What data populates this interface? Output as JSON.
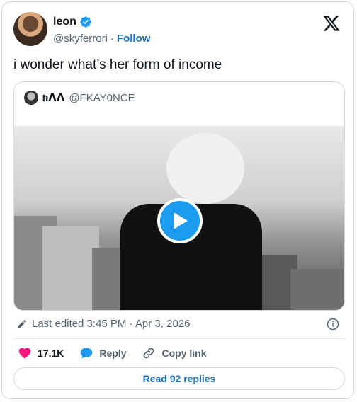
{
  "author": {
    "name": "leon",
    "handle": "@skyferrori",
    "separator": "·",
    "follow_label": "Follow"
  },
  "tweet": {
    "text": "i wonder what’s her form of income"
  },
  "quoted": {
    "name": "ክᐱᐱ",
    "handle": "@FKAY0NCE"
  },
  "meta": {
    "edited_text": "Last edited 3:45 PM · Apr 3, 2026"
  },
  "actions": {
    "like_count": "17.1K",
    "reply_label": "Reply",
    "copy_label": "Copy link"
  },
  "read_replies_label": "Read 92 replies",
  "colors": {
    "like": "#f91880",
    "reply": "#1d9bf0",
    "link": "#1d72b8",
    "verified": "#1d9bf0"
  }
}
